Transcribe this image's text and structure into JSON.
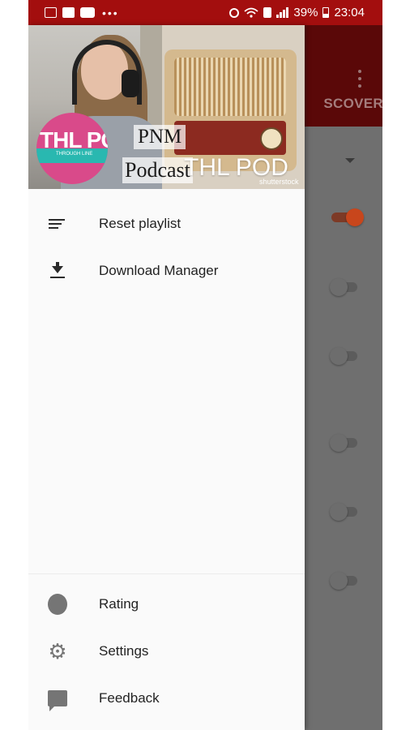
{
  "status_bar": {
    "battery": "39%",
    "time": "23:04",
    "overflow_dots": "•••",
    "colors": {
      "background": "#a30e0e"
    }
  },
  "background_app": {
    "tab_label": "SCOVER",
    "toggles": [
      {
        "state": "on"
      },
      {
        "state": "off"
      },
      {
        "state": "off"
      },
      {
        "state": "off"
      },
      {
        "state": "off"
      },
      {
        "state": "off"
      }
    ],
    "colors": {
      "accent": "#c8461c"
    }
  },
  "drawer": {
    "header": {
      "logo_text": "THL POD",
      "logo_subtext": "THROUGH LINE",
      "overlay_line1": "PNM",
      "overlay_line2": "Podcast",
      "overlay_brand": "THL POD",
      "watermark": "shutterstock"
    },
    "menu_items": [
      {
        "label": "Reset playlist",
        "icon": "reset-playlist-icon"
      },
      {
        "label": "Download Manager",
        "icon": "download-icon"
      }
    ],
    "footer_items": [
      {
        "label": "Rating",
        "icon": "rating-icon"
      },
      {
        "label": "Settings",
        "icon": "settings-gear-icon"
      },
      {
        "label": "Feedback",
        "icon": "feedback-icon"
      }
    ]
  }
}
